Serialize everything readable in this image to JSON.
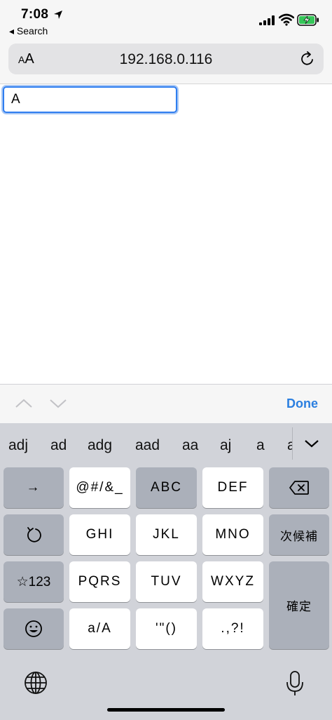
{
  "status_bar": {
    "time": "7:08",
    "back_label": "◂ Search"
  },
  "browser": {
    "text_size_button": "AA",
    "address": "192.168.0.116"
  },
  "page": {
    "text_field_value": "A"
  },
  "accessory_bar": {
    "done_label": "Done"
  },
  "keyboard": {
    "suggestions": [
      "adj",
      "ad",
      "adg",
      "aad",
      "aa",
      "aj",
      "a",
      "a"
    ],
    "keys": {
      "arrow": "→",
      "symbols": "@#/&_",
      "abc": "ABC",
      "def": "DEF",
      "undo": "↺",
      "ghi": "GHI",
      "jkl": "JKL",
      "mno": "MNO",
      "next_candidate": "次候補",
      "num": "☆123",
      "pqrs": "PQRS",
      "tuv": "TUV",
      "wxyz": "WXYZ",
      "confirm": "確定",
      "emoji": "☺",
      "case": "a/A",
      "quotes": "'\"()",
      "punct": ".,?!"
    }
  }
}
